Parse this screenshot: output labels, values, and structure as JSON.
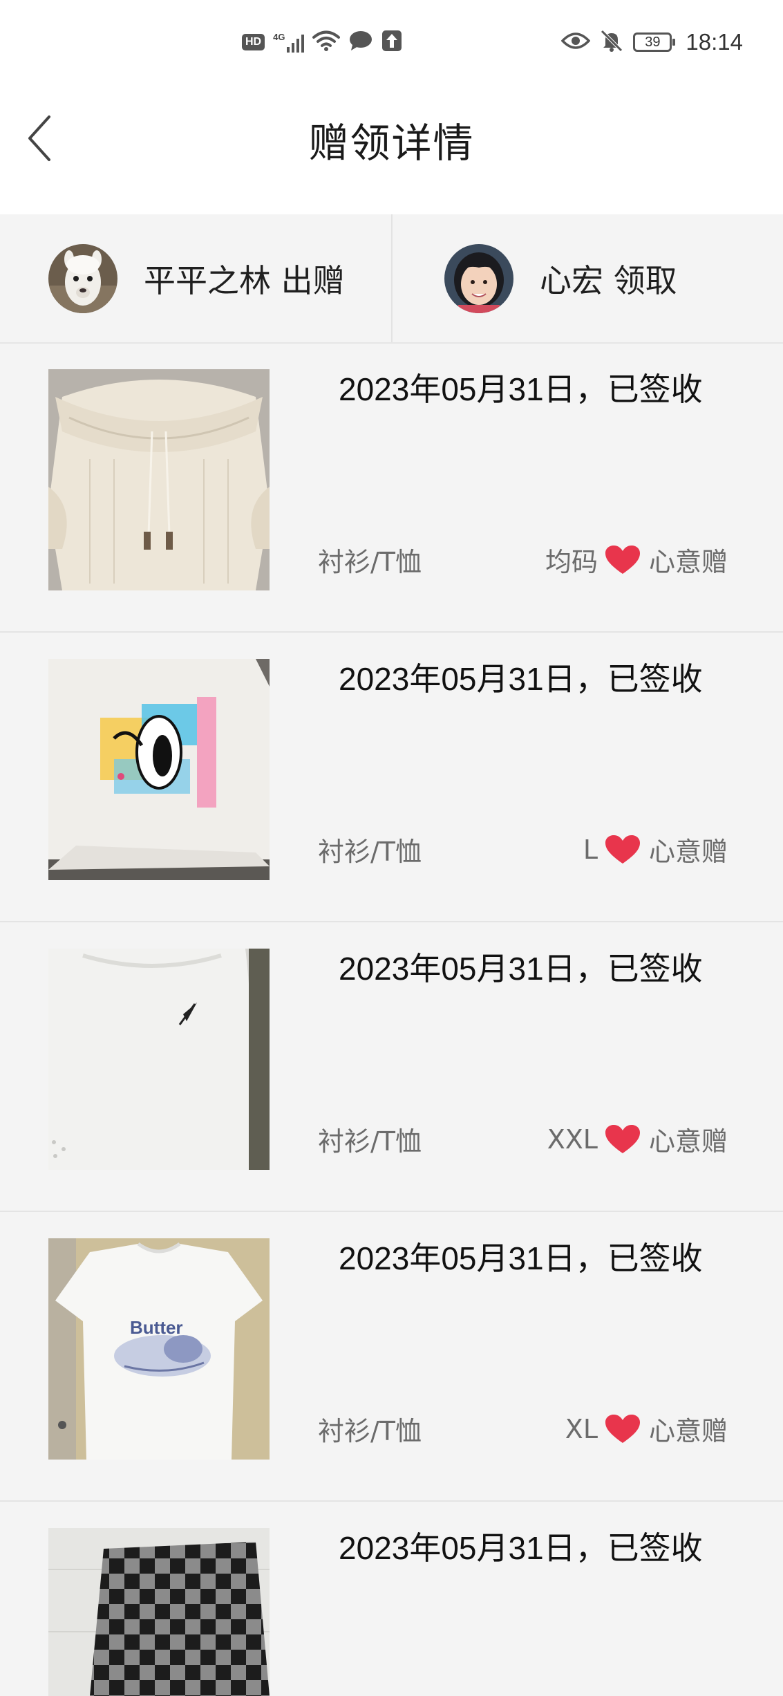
{
  "status_bar": {
    "left_icons": [
      "hd-icon",
      "signal-4g-icon",
      "wifi-icon",
      "message-icon",
      "upload-icon"
    ],
    "hd_label": "HD",
    "network_label": "4G",
    "right_icons": [
      "eye-icon",
      "mute-bell-icon",
      "battery-icon"
    ],
    "battery_level": "39",
    "time": "18:14"
  },
  "header": {
    "title": "赠领详情",
    "back_icon": "chevron-left-icon"
  },
  "parties": {
    "giver": {
      "name": "平平之林",
      "action": "出赠",
      "label": "平平之林 出赠"
    },
    "receiver": {
      "name": "心宏",
      "action": "领取",
      "label": "心宏 领取"
    }
  },
  "items": [
    {
      "date_status": "2023年05月31日，已签收",
      "category": "衬衫/T恤",
      "size": "均码",
      "gift_label": "心意赠"
    },
    {
      "date_status": "2023年05月31日，已签收",
      "category": "衬衫/T恤",
      "size": "L",
      "gift_label": "心意赠"
    },
    {
      "date_status": "2023年05月31日，已签收",
      "category": "衬衫/T恤",
      "size": "XXL",
      "gift_label": "心意赠"
    },
    {
      "date_status": "2023年05月31日，已签收",
      "category": "衬衫/T恤",
      "size": "XL",
      "gift_label": "心意赠"
    },
    {
      "date_status": "2023年05月31日，已签收",
      "category": "",
      "size": "",
      "gift_label": ""
    }
  ],
  "product_text": {
    "item4_print": "Butter"
  },
  "colors": {
    "heart": "#e8354c",
    "background": "#f4f4f4",
    "header_bg": "#ffffff",
    "secondary_text": "#6b6b6b"
  }
}
